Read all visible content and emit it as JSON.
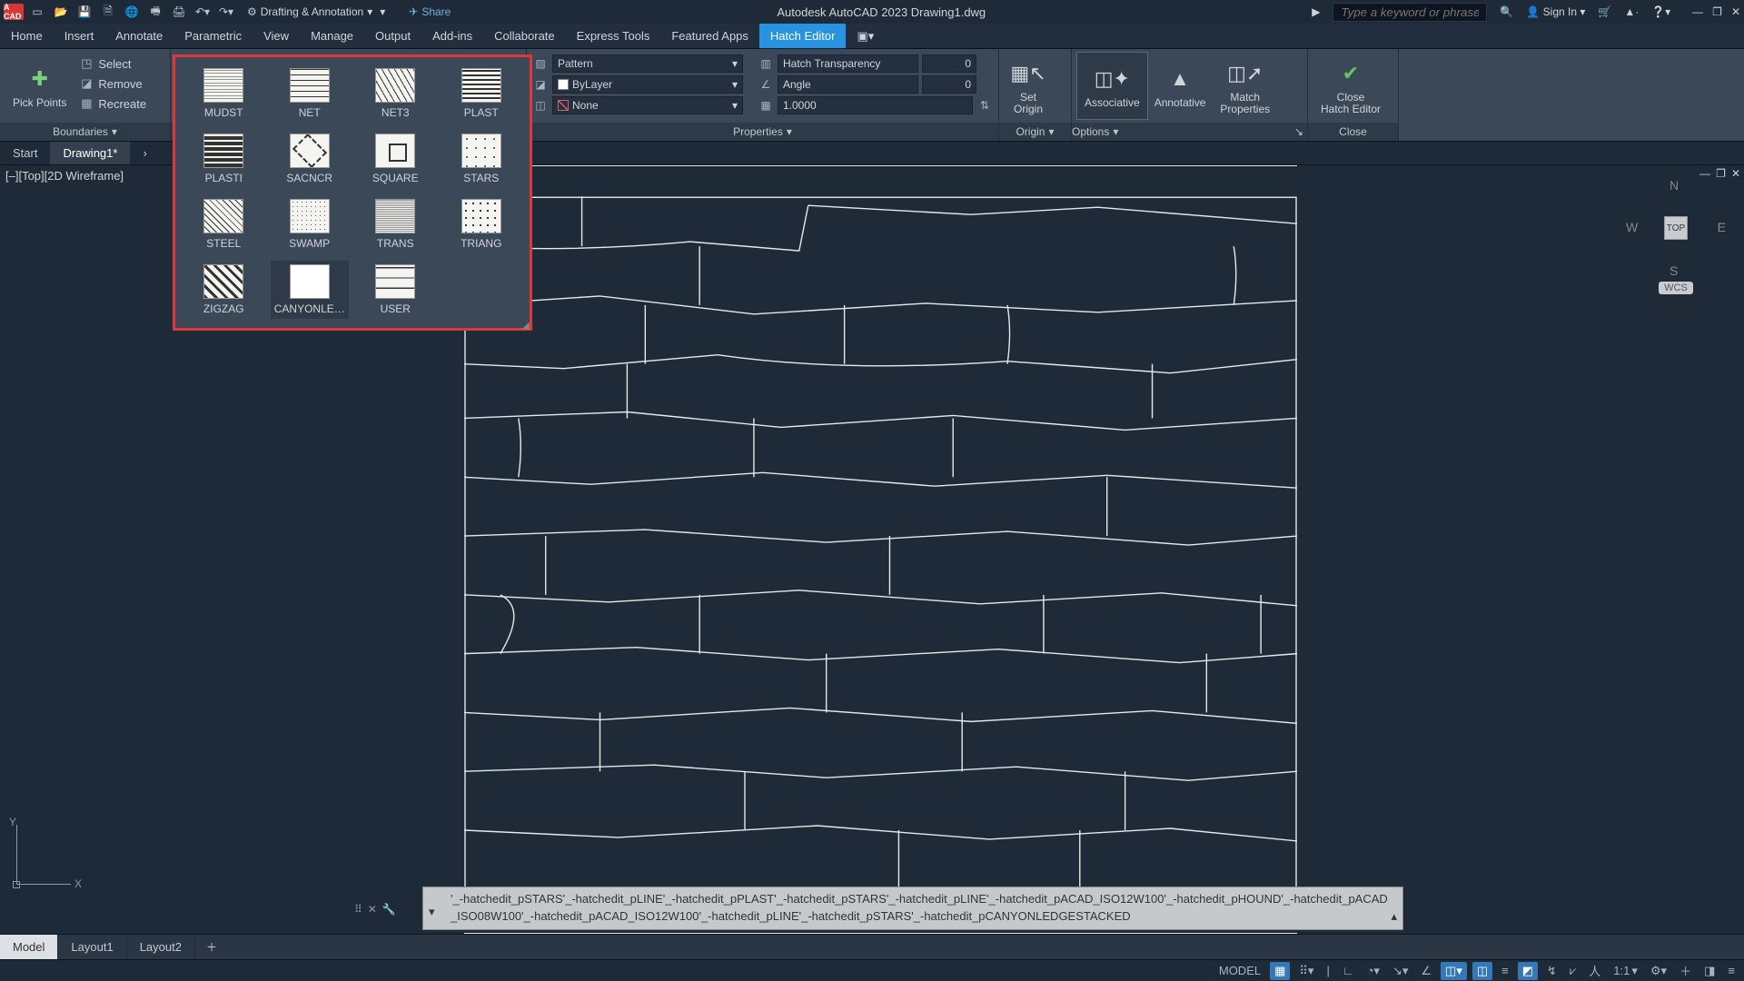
{
  "titlebar": {
    "app_badge": "A CAD",
    "workspace": "Drafting & Annotation",
    "share": "Share",
    "title": "Autodesk AutoCAD 2023   Drawing1.dwg",
    "search_placeholder": "Type a keyword or phrase",
    "signin": "Sign In"
  },
  "menu": {
    "items": [
      "Home",
      "Insert",
      "Annotate",
      "Parametric",
      "View",
      "Manage",
      "Output",
      "Add-ins",
      "Collaborate",
      "Express Tools",
      "Featured Apps",
      "Hatch Editor"
    ],
    "active": "Hatch Editor"
  },
  "ribbon": {
    "boundaries": {
      "pick": "Pick Points",
      "select": "Select",
      "remove": "Remove",
      "recreate": "Recreate",
      "label": "Boundaries"
    },
    "patterns": [
      {
        "id": "MUDST",
        "sw": "mudst"
      },
      {
        "id": "NET",
        "sw": "net"
      },
      {
        "id": "NET3",
        "sw": "net3"
      },
      {
        "id": "PLAST",
        "sw": "plast"
      },
      {
        "id": "PLASTI",
        "sw": "plasti"
      },
      {
        "id": "SACNCR",
        "sw": "sacncr"
      },
      {
        "id": "SQUARE",
        "sw": "square"
      },
      {
        "id": "STARS",
        "sw": "stars"
      },
      {
        "id": "STEEL",
        "sw": "steel"
      },
      {
        "id": "SWAMP",
        "sw": "swamp"
      },
      {
        "id": "TRANS",
        "sw": "trans"
      },
      {
        "id": "TRIANG",
        "sw": "triang"
      },
      {
        "id": "ZIGZAG",
        "sw": "zigzag"
      },
      {
        "id": "CANYONLE…",
        "sw": "canyon",
        "sel": true
      },
      {
        "id": "USER",
        "sw": "user"
      }
    ],
    "properties": {
      "type_label": "Pattern",
      "color_label": "ByLayer",
      "bg_label": "None",
      "transp_label": "Hatch Transparency",
      "transp_val": "0",
      "angle_label": "Angle",
      "angle_val": "0",
      "scale_val": "1.0000",
      "group": "Properties"
    },
    "origin": {
      "btn": "Set Origin",
      "group": "Origin"
    },
    "options": {
      "assoc": "Associative",
      "annot": "Annotative",
      "match": "Match Properties",
      "group": "Options"
    },
    "close": {
      "btn": "Close Hatch Editor",
      "group": "Close"
    }
  },
  "doc_tabs": {
    "items": [
      "Start",
      "Drawing1*"
    ],
    "active": "Drawing1*"
  },
  "viewport": {
    "label": "[–][Top][2D Wireframe]",
    "cube_top": "TOP",
    "n": "N",
    "s": "S",
    "e": "E",
    "w": "W",
    "wcs": "WCS"
  },
  "command": {
    "text": "'_-hatchedit_pSTARS'_-hatchedit_pLINE'_-hatchedit_pPLAST'_-hatchedit_pSTARS'_-hatchedit_pLINE'_-hatchedit_pACAD_ISO12W100'_-hatchedit_pHOUND'_-hatchedit_pACAD_ISO08W100'_-hatchedit_pACAD_ISO12W100'_-hatchedit_pLINE'_-hatchedit_pSTARS'_-hatchedit_pCANYONLEDGESTACKED"
  },
  "layout_tabs": {
    "items": [
      "Model",
      "Layout1",
      "Layout2"
    ],
    "active": "Model"
  },
  "status": {
    "model": "MODEL",
    "scale": "1:1"
  }
}
